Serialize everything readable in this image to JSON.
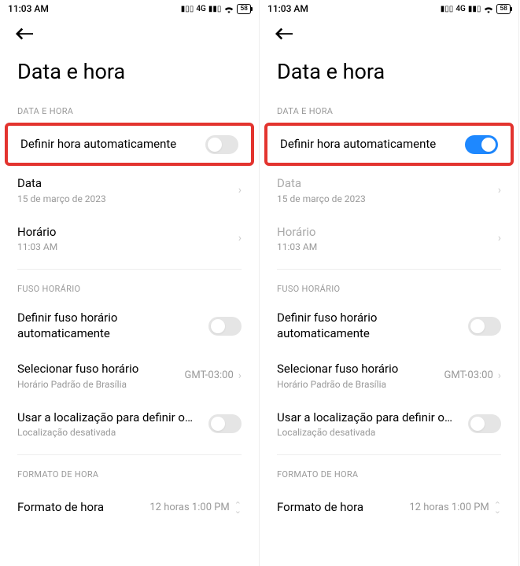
{
  "status": {
    "time": "11:03 AM",
    "battery": "58",
    "network": "4G"
  },
  "nav": {
    "title": "Data e hora"
  },
  "sections": {
    "date_time_header": "DATA E HORA",
    "auto_time": "Definir hora automaticamente",
    "date_label": "Data",
    "date_value": "15 de março de 2023",
    "time_label": "Horário",
    "time_value": "11:03 AM",
    "tz_header": "FUSO HORÁRIO",
    "auto_tz_l1": "Definir fuso horário",
    "auto_tz_l2": "automaticamente",
    "select_tz_label": "Selecionar fuso horário",
    "select_tz_sub": "Horário Padrão de Brasília",
    "select_tz_value": "GMT-03:00",
    "use_loc_label": "Usar a localização para definir o…",
    "use_loc_sub": "Localização desativada",
    "format_header": "FORMATO DE HORA",
    "format_label": "Formato de hora",
    "format_value": "12 horas 1:00 PM"
  },
  "left": {
    "auto_time_on": false
  },
  "right": {
    "auto_time_on": true
  }
}
